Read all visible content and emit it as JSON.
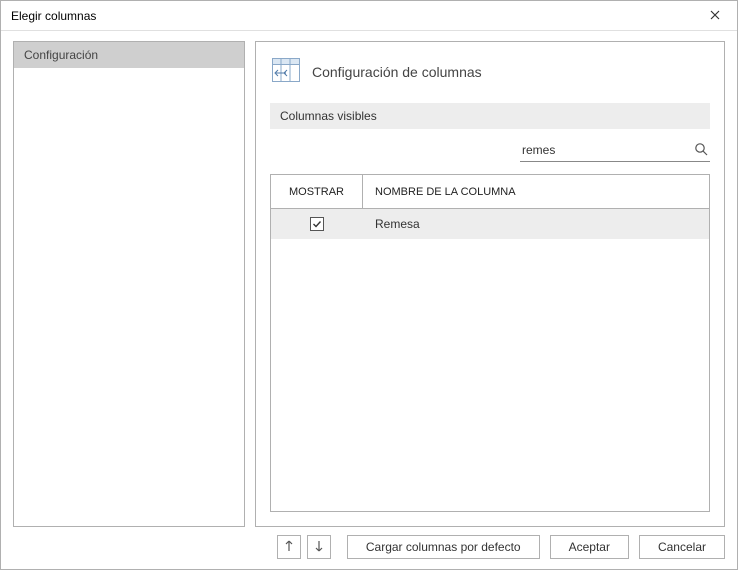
{
  "window": {
    "title": "Elegir columnas"
  },
  "sidebar": {
    "items": [
      {
        "label": "Configuración",
        "selected": true
      }
    ]
  },
  "main": {
    "heading": "Configuración de columnas",
    "section_label": "Columnas visibles",
    "search": {
      "value": "remes",
      "placeholder": ""
    },
    "table": {
      "columns": {
        "mostrar": "MOSTRAR",
        "nombre": "NOMBRE DE LA COLUMNA"
      },
      "rows": [
        {
          "checked": true,
          "name": "Remesa",
          "selected": true
        }
      ]
    }
  },
  "footer": {
    "load_defaults": "Cargar columnas por defecto",
    "accept": "Aceptar",
    "cancel": "Cancelar"
  }
}
